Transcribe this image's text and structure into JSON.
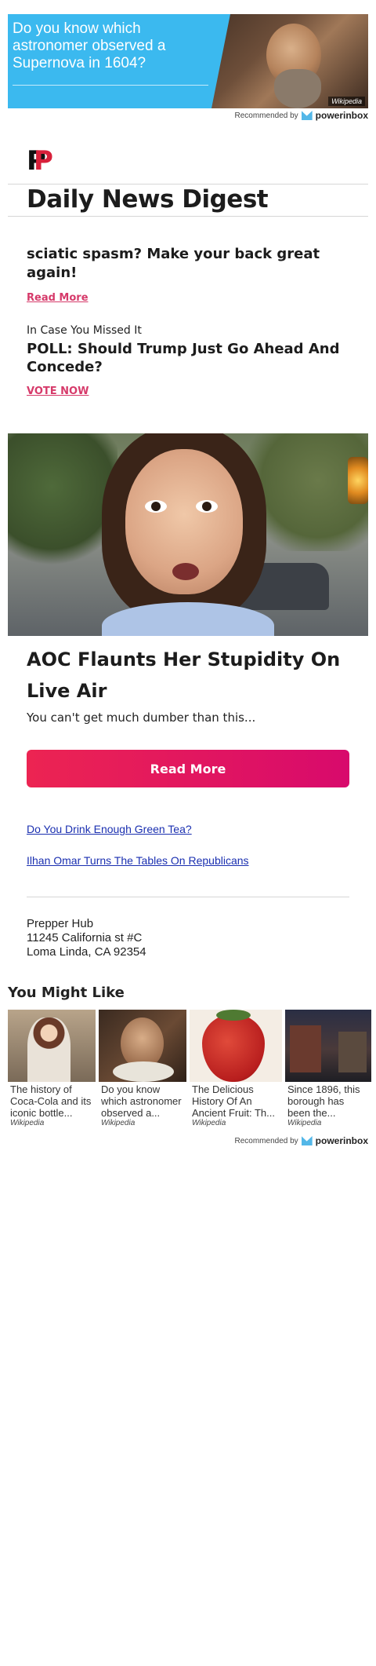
{
  "top_ad": {
    "headline": "Do you know which astronomer observed a Supernova in 1604?",
    "source": "Wikipedia"
  },
  "recommended": {
    "label": "Recommended by",
    "brand": "powerinbox"
  },
  "header": {
    "logo_letters": [
      "P",
      "P"
    ],
    "title": "Daily News Digest"
  },
  "promo1": {
    "headline": "sciatic spasm? Make your back great again!",
    "link": "Read More"
  },
  "promo2": {
    "eyebrow": "In Case You Missed It",
    "headline": "POLL: Should Trump Just Go Ahead And Concede?",
    "link": "VOTE NOW"
  },
  "article": {
    "title": "AOC Flaunts Her Stupidity On Live Air",
    "subtitle": "You can't get much dumber than this...",
    "cta": "Read More"
  },
  "links": [
    "Do You Drink Enough Green Tea?",
    "Ilhan Omar Turns The Tables On Republicans"
  ],
  "footer": {
    "name": "Prepper Hub",
    "street": "11245 California st #C",
    "city": "Loma Linda, CA 92354"
  },
  "you_might_like": {
    "heading": "You Might Like",
    "cards": [
      {
        "text": "The history of Coca-Cola and its iconic bottle...",
        "source": "Wikipedia"
      },
      {
        "text": "Do you know which astronomer observed a...",
        "source": "Wikipedia"
      },
      {
        "text": "The Delicious History Of An Ancient Fruit: Th...",
        "source": "Wikipedia"
      },
      {
        "text": "Since 1896, this borough has been the...",
        "source": "Wikipedia"
      }
    ]
  },
  "colors": {
    "ad_blue": "#3bb9ef",
    "accent_pink": "#d63a6a",
    "cta_start": "#ec2452",
    "cta_end": "#d80a6c",
    "link_blue": "#1a2fb0"
  }
}
